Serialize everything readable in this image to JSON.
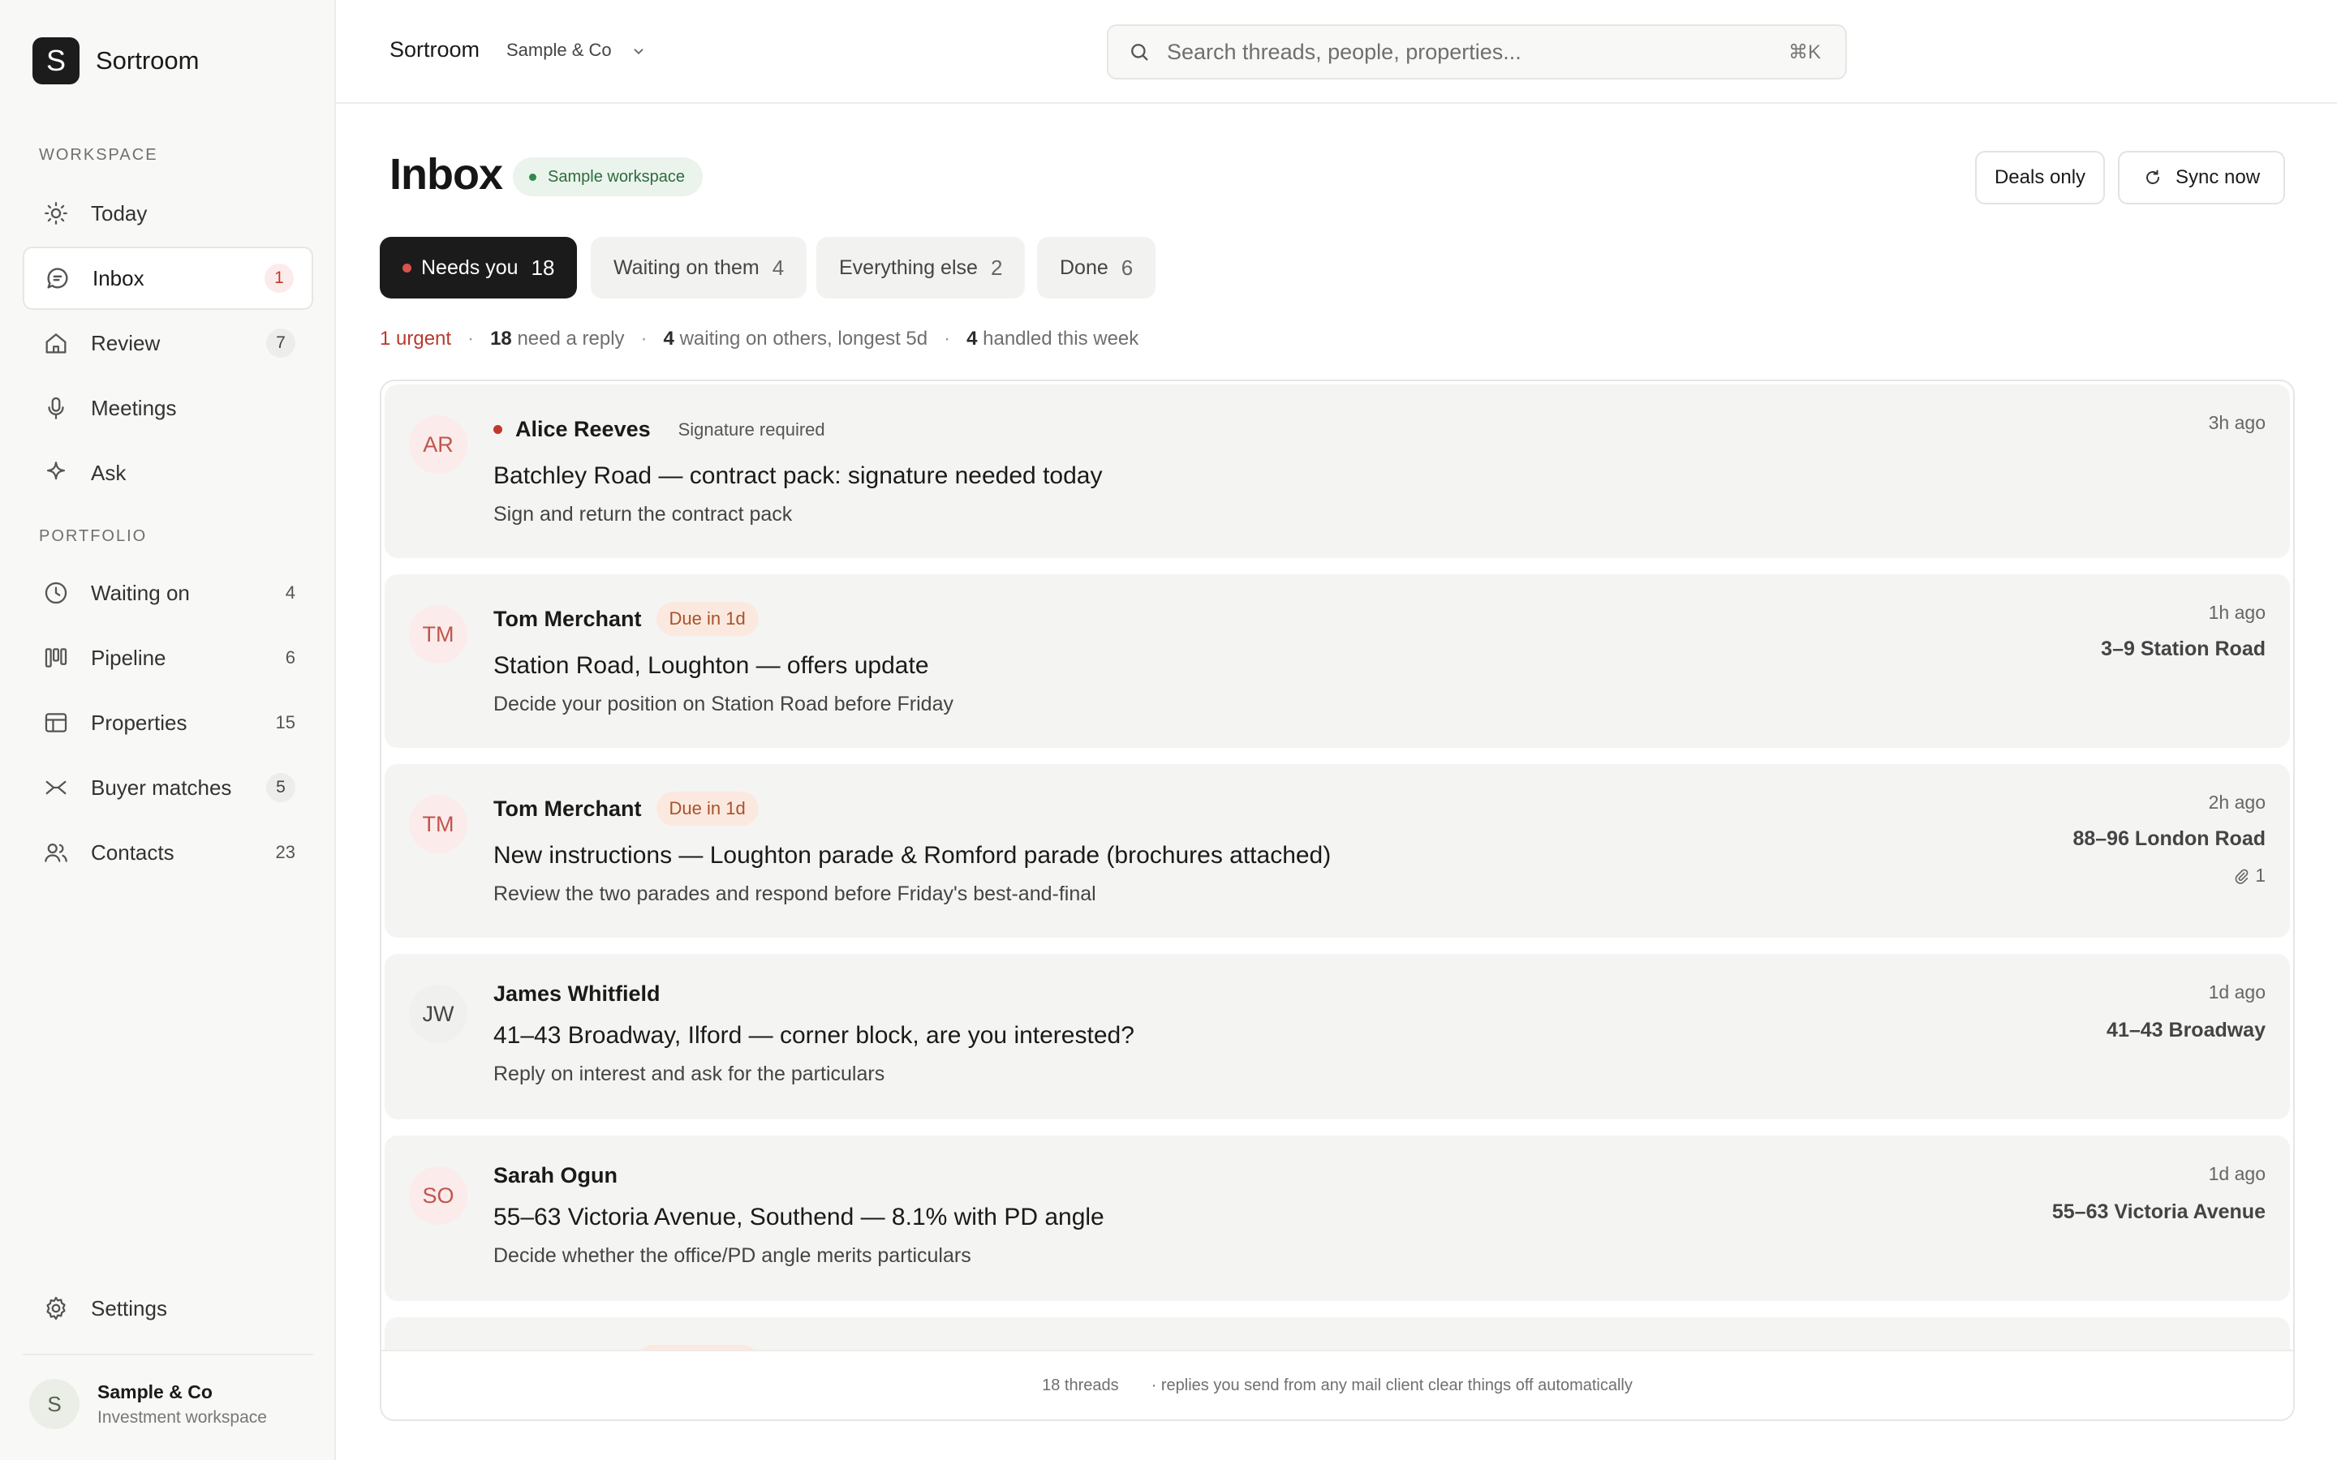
{
  "app": {
    "name": "Sortroom",
    "logo_letter": "S"
  },
  "sidebar": {
    "workspace_label": "WORKSPACE",
    "portfolio_label": "PORTFOLIO",
    "workspace_items": [
      {
        "label": "Today",
        "icon": "sun-icon",
        "count": ""
      },
      {
        "label": "Inbox",
        "icon": "chat-icon",
        "count": "1"
      },
      {
        "label": "Review",
        "icon": "home-icon",
        "count": "7"
      },
      {
        "label": "Meetings",
        "icon": "microphone-icon",
        "count": ""
      },
      {
        "label": "Ask",
        "icon": "sparkle-icon",
        "count": ""
      }
    ],
    "portfolio_items": [
      {
        "label": "Waiting on",
        "icon": "clock-icon",
        "count": "4"
      },
      {
        "label": "Pipeline",
        "icon": "kanban-icon",
        "count": "6"
      },
      {
        "label": "Properties",
        "icon": "table-icon",
        "count": "15"
      },
      {
        "label": "Buyer matches",
        "icon": "match-icon",
        "count": "5"
      },
      {
        "label": "Contacts",
        "icon": "people-icon",
        "count": "23"
      }
    ],
    "settings_label": "Settings",
    "account": {
      "avatar": "S",
      "name": "Sample & Co",
      "subtitle": "Investment workspace"
    }
  },
  "topbar": {
    "app_crumb": "Sortroom",
    "org_crumb": "Sample & Co",
    "search_placeholder": "Search threads, people, properties...",
    "search_shortcut": "⌘K"
  },
  "header": {
    "title": "Inbox",
    "workspace_badge": "Sample workspace",
    "deals_only_label": "Deals only",
    "sync_label": "Sync now"
  },
  "tabs": [
    {
      "label": "Needs you",
      "count": "18"
    },
    {
      "label": "Waiting on them",
      "count": "4"
    },
    {
      "label": "Everything else",
      "count": "2"
    },
    {
      "label": "Done",
      "count": "6"
    }
  ],
  "summary": {
    "urgent": "1 urgent",
    "reply_count": "18",
    "reply_text": "need a reply",
    "waiting_count": "4",
    "waiting_text": "waiting on others, longest 5d",
    "handled_count": "4",
    "handled_text": "handled this week",
    "separator": "·"
  },
  "threads": [
    {
      "initials": "AR",
      "name": "Alice Reeves",
      "tag": "Signature required",
      "title": "Batchley Road — contract pack: signature needed today",
      "subtitle": "Sign and return the contract pack",
      "time": "3h ago",
      "property": "",
      "attachments": ""
    },
    {
      "initials": "TM",
      "name": "Tom Merchant",
      "tag": "Due in 1d",
      "title": "Station Road, Loughton — offers update",
      "subtitle": "Decide your position on Station Road before Friday",
      "time": "1h ago",
      "property": "3–9 Station Road",
      "attachments": ""
    },
    {
      "initials": "TM",
      "name": "Tom Merchant",
      "tag": "Due in 1d",
      "title": "New instructions — Loughton parade & Romford parade (brochures attached)",
      "subtitle": "Review the two parades and respond before Friday's best-and-final",
      "time": "2h ago",
      "property": "88–96 London Road",
      "attachments": "1"
    },
    {
      "initials": "JW",
      "name": "James Whitfield",
      "tag": "",
      "title": "41–43 Broadway, Ilford — corner block, are you interested?",
      "subtitle": "Reply on interest and ask for the particulars",
      "time": "1d ago",
      "property": "41–43 Broadway",
      "attachments": ""
    },
    {
      "initials": "SO",
      "name": "Sarah Ogun",
      "tag": "",
      "title": "55–63 Victoria Avenue, Southend — 8.1% with PD angle",
      "subtitle": "Decide whether the office/PD angle merits particulars",
      "time": "1d ago",
      "property": "55–63 Victoria Avenue",
      "attachments": ""
    }
  ],
  "footer": {
    "thread_count": "18 threads",
    "note": "· replies you send from any mail client clear things off automatically"
  },
  "colors": {
    "accent_dark": "#1b1b1b",
    "urgent_red": "#b73a30",
    "due_orange": "#a8522a",
    "workspace_green": "#2f6b3f"
  }
}
